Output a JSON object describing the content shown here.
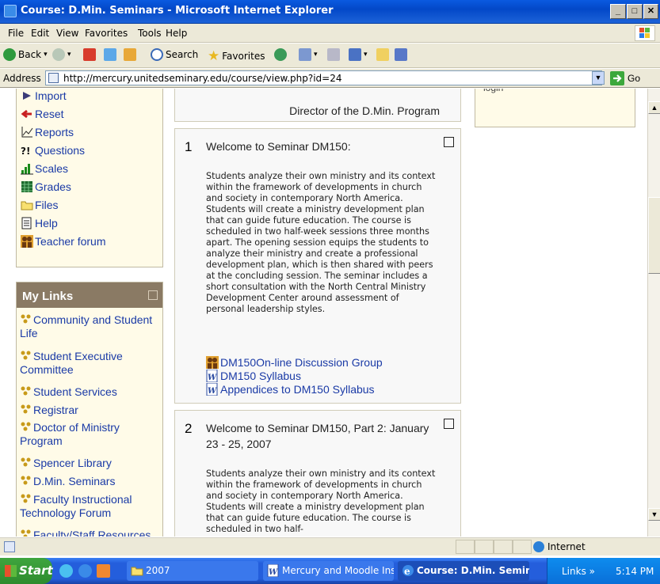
{
  "window": {
    "title": "Course: D.Min. Seminars - Microsoft Internet Explorer"
  },
  "menu": [
    "File",
    "Edit",
    "View",
    "Favorites",
    "Tools",
    "Help"
  ],
  "toolbar": {
    "back": "Back",
    "search": "Search",
    "favorites": "Favorites"
  },
  "address": {
    "label": "Address",
    "url": "http://mercury.unitedseminary.edu/course/view.php?id=24",
    "go": "Go"
  },
  "admin": {
    "items": [
      "Import",
      "Reset",
      "Reports",
      "Questions",
      "Scales",
      "Grades",
      "Files",
      "Help",
      "Teacher forum"
    ]
  },
  "my_links": {
    "title": "My Links",
    "items": [
      "Community and Student Life",
      "Student Executive Committee",
      "Student Services",
      "Registrar",
      "Doctor of Ministry Program",
      "Spencer Library",
      "D.Min. Seminars",
      "Faculty Instructional Technology Forum",
      "Faculty/Staff Resources"
    ]
  },
  "center": {
    "director": "Director of the D.Min. Program",
    "topics": [
      {
        "number": "1",
        "title": "Welcome to Seminar DM150:",
        "body": "Students analyze their own ministry and its context within the framework of developments in church and society in contemporary North America. Students will create a ministry development plan that can guide future education. The course is scheduled in two half-week sessions three months apart. The opening session equips the students to analyze their ministry and create a professional development plan, which is then shared with peers at the concluding session. The seminar includes a short consultation with the North Central Ministry Development Center around assessment of personal leadership styles.",
        "resources": [
          "DM150On-line Discussion Group",
          "DM150 Syllabus",
          "Appendices to DM150 Syllabus"
        ]
      },
      {
        "number": "2",
        "title": "Welcome to Seminar DM150, Part 2: January 23 - 25, 2007",
        "body": "Students analyze their own ministry and its context within the framework of developments in church and society in contemporary North America. Students will create a ministry development plan that can guide future education. The course is scheduled in two half-"
      }
    ]
  },
  "right": {
    "text": "login"
  },
  "status": {
    "zone": "Internet"
  },
  "taskbar": {
    "start": "Start",
    "buttons": [
      "2007",
      "Mercury and Moodle Inst...",
      "Course: D.Min. Semin..."
    ],
    "links": "Links",
    "chevron": "»",
    "time": "5:14 PM"
  },
  "colors": {
    "link": "#1a3aa6",
    "block_bg": "#fffbe8",
    "header_bg": "#8a7a64"
  }
}
